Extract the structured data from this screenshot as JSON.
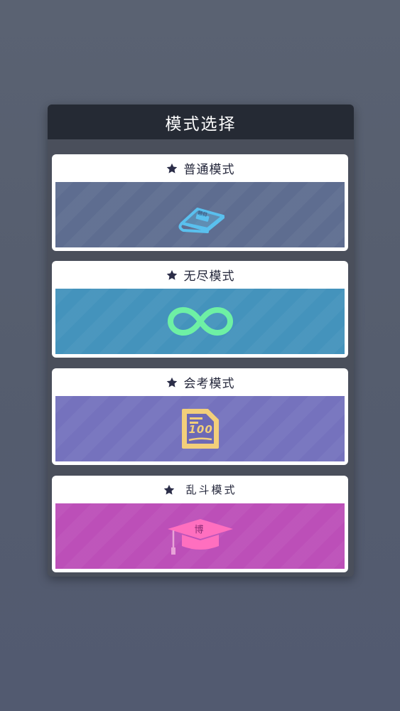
{
  "panel": {
    "title": "模式选择"
  },
  "modes": [
    {
      "label": "普通模式",
      "icon": "book-icon",
      "book_label": "题目",
      "color": "#5e6d90"
    },
    {
      "label": "无尽模式",
      "icon": "infinity-icon",
      "color": "#4493bc"
    },
    {
      "label": "会考模式",
      "icon": "exam-paper-icon",
      "score": "100",
      "color": "#7572bd"
    },
    {
      "label": "乱斗模式",
      "icon": "graduation-cap-icon",
      "cap_label": "博",
      "color": "#bc4fb8"
    }
  ]
}
